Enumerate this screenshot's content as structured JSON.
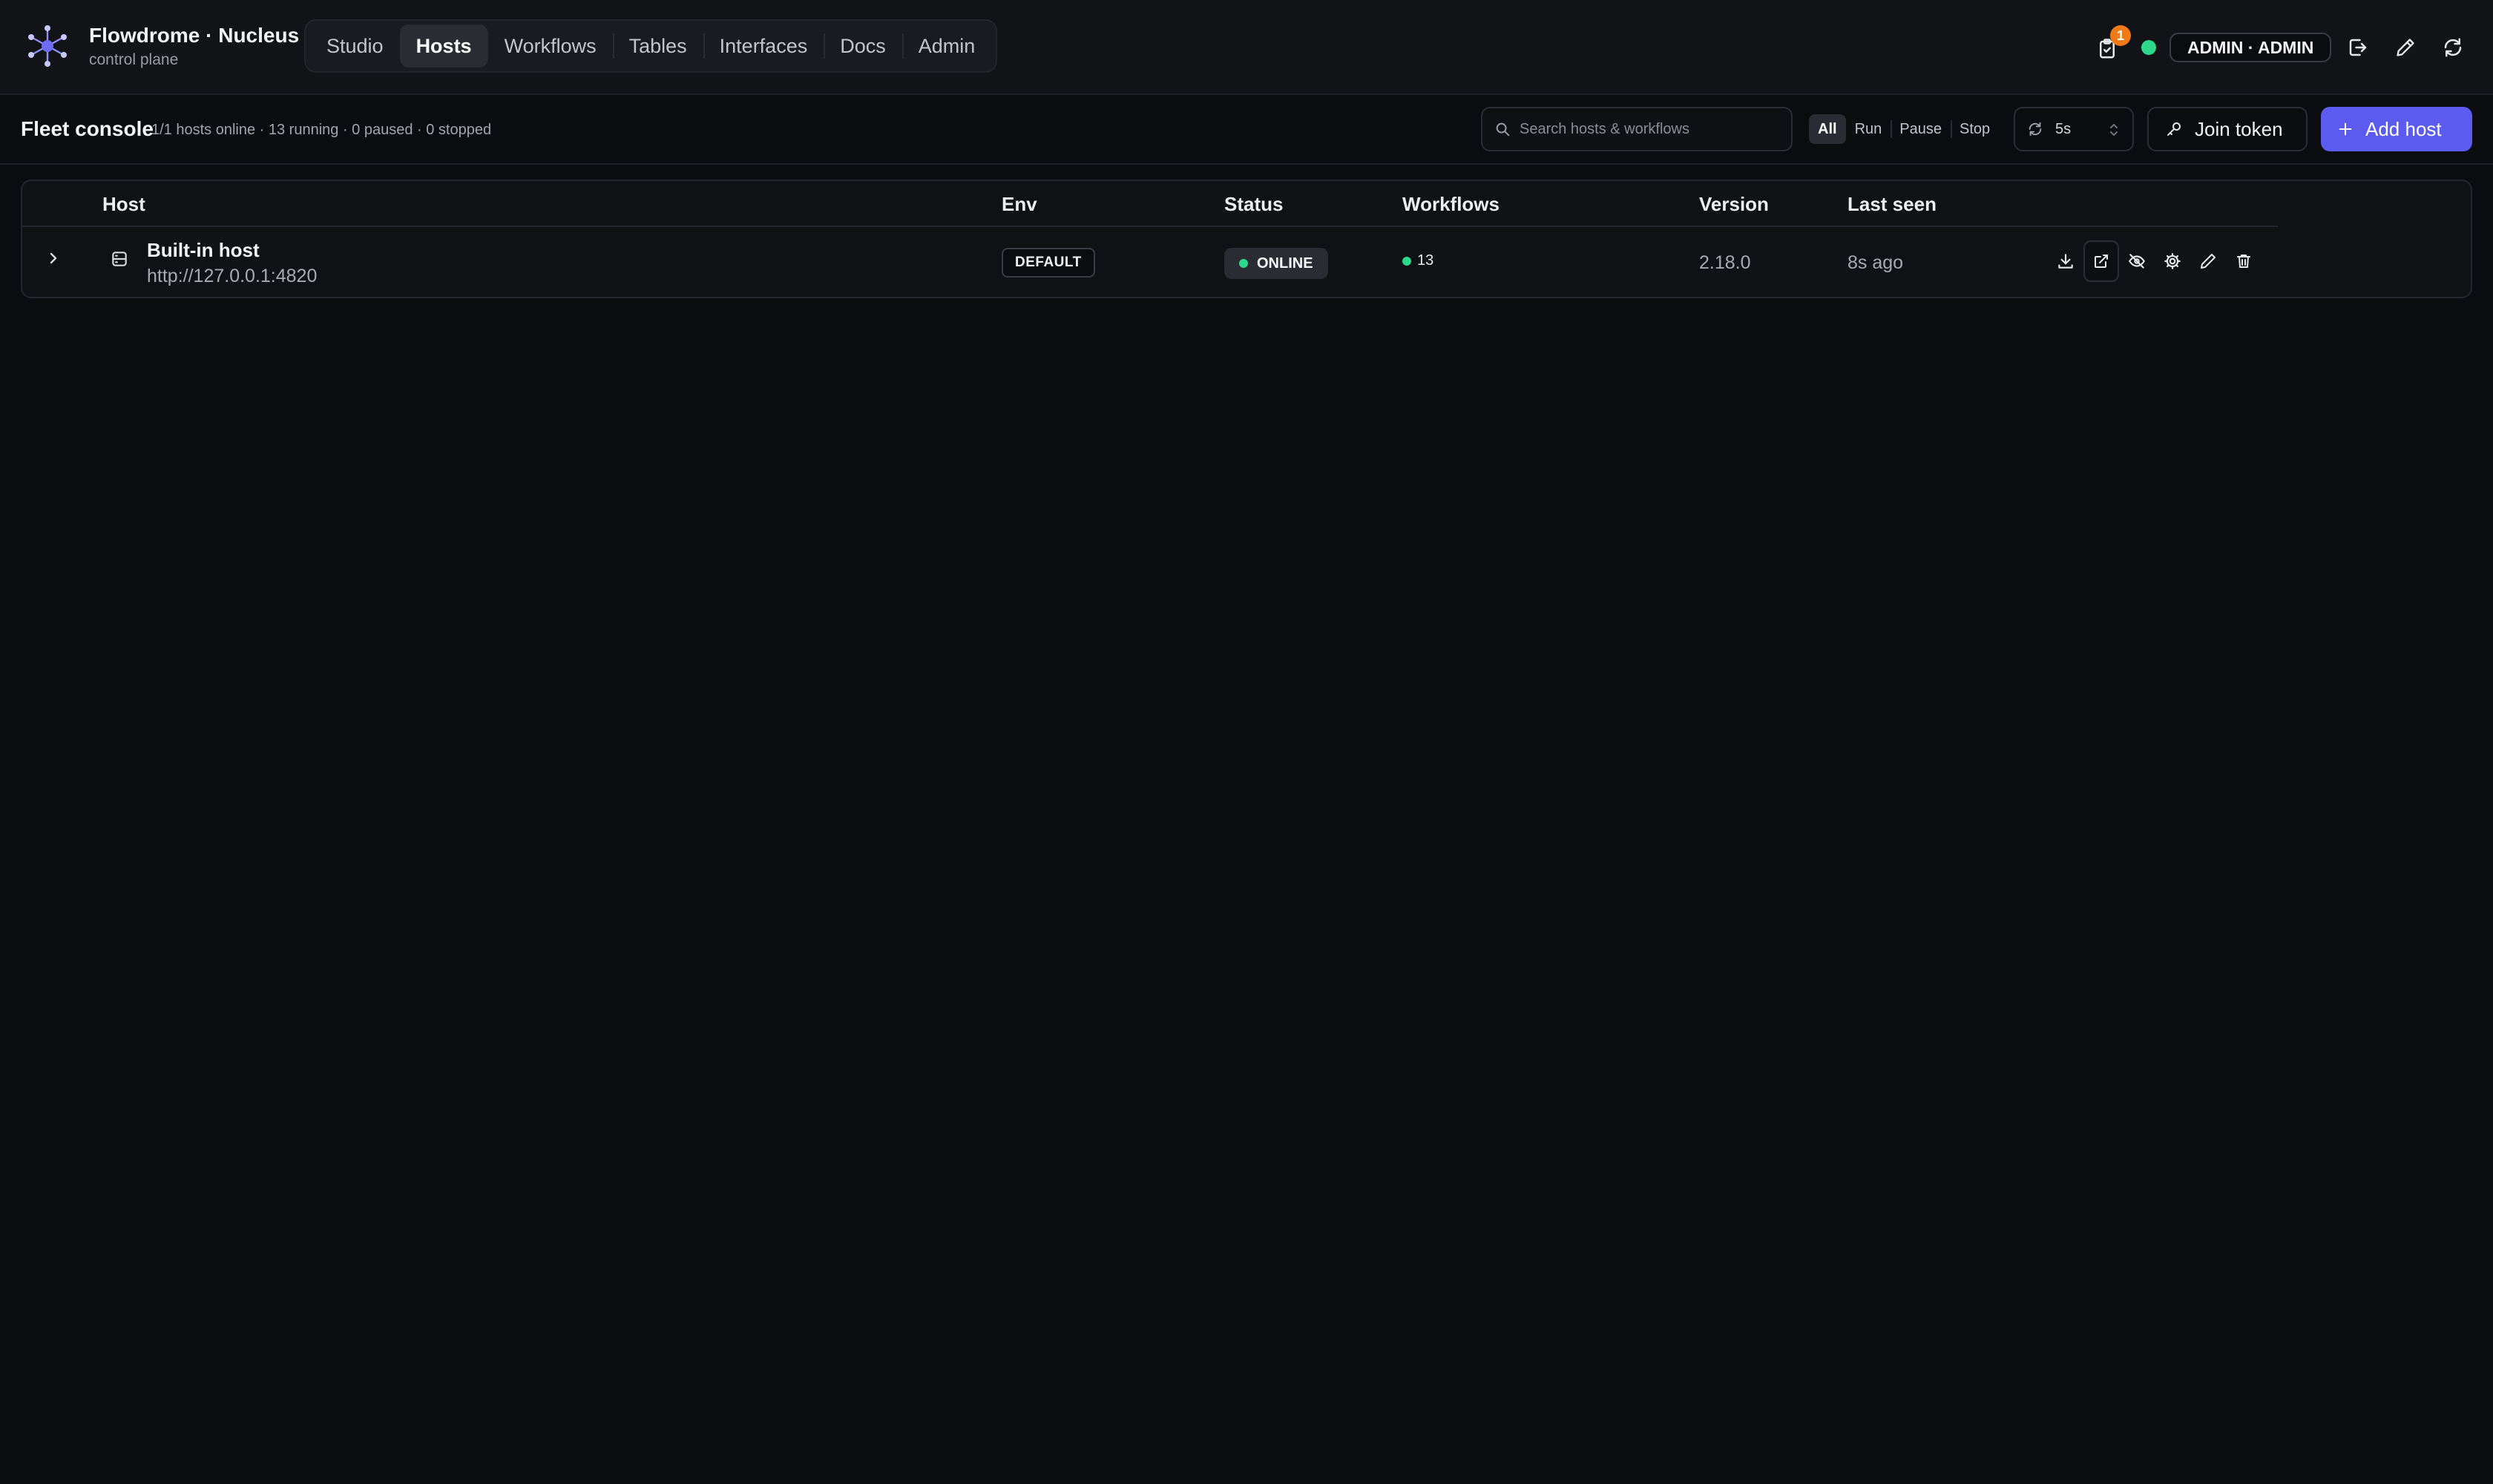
{
  "app": {
    "name": "Flowdrome · Nucleus",
    "subtitle": "control plane"
  },
  "nav": {
    "tabs": [
      {
        "label": "Studio",
        "active": false
      },
      {
        "label": "Hosts",
        "active": true
      },
      {
        "label": "Workflows",
        "active": false
      },
      {
        "label": "Tables",
        "active": false
      },
      {
        "label": "Interfaces",
        "active": false
      },
      {
        "label": "Docs",
        "active": false
      },
      {
        "label": "Admin",
        "active": false
      }
    ]
  },
  "header_right": {
    "notification_count": "1",
    "user_label": "ADMIN · ADMIN",
    "connection_status_color": "#2dd88a"
  },
  "page": {
    "title": "Fleet console",
    "stats": "1/1 hosts online · 13 running · 0 paused · 0 stopped"
  },
  "search": {
    "placeholder": "Search hosts & workflows",
    "value": ""
  },
  "filters": [
    {
      "label": "All",
      "active": true
    },
    {
      "label": "Run",
      "active": false
    },
    {
      "label": "Pause",
      "active": false
    },
    {
      "label": "Stop",
      "active": false
    }
  ],
  "refresh": {
    "interval": "5s"
  },
  "buttons": {
    "join_token": "Join token",
    "add_host": "Add host"
  },
  "table": {
    "columns": [
      "Host",
      "Env",
      "Status",
      "Workflows",
      "Version",
      "Last seen"
    ],
    "rows": [
      {
        "name": "Built-in host",
        "url": "http://127.0.0.1:4820",
        "env": "DEFAULT",
        "status": "ONLINE",
        "workflows": "13",
        "version": "2.18.0",
        "last_seen": "8s ago"
      }
    ]
  },
  "colors": {
    "accent": "#5b5bef",
    "online": "#2dd88a",
    "badge": "#f07a18",
    "background": "#0b0c10"
  }
}
